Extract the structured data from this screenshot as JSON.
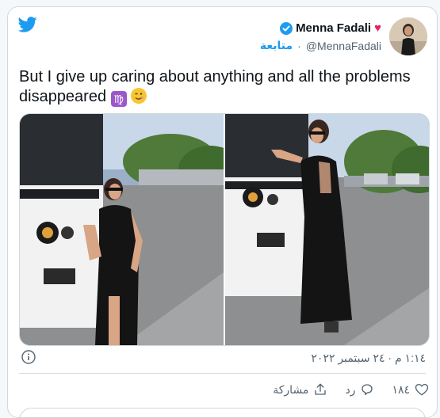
{
  "author": {
    "display_name": "Menna Fadali",
    "handle": "@MennaFadali",
    "follow_label": "متابعة",
    "heart_emoji": "♥"
  },
  "tweet": {
    "text": "But I give up caring about anything and all the problems disappeared",
    "emoji_1": "♍",
    "timestamp": "١:١٤ م · ٢٤ سبتمبر ٢٠٢٢"
  },
  "actions": {
    "like_count": "١٨٤",
    "reply_label": "رد",
    "share_label": "مشاركة"
  },
  "colors": {
    "brand_blue": "#1d9bf0",
    "heart_red": "#e0245e",
    "text_primary": "#0f1419",
    "text_secondary": "#536471"
  }
}
